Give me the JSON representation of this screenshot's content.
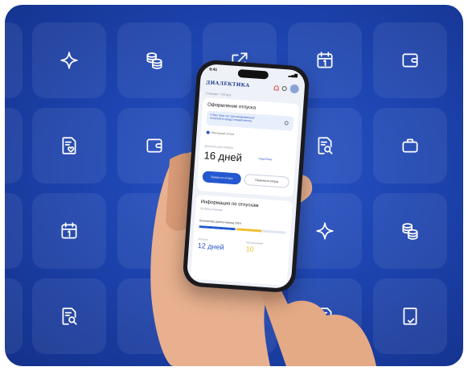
{
  "colors": {
    "background_deep": "#14318a",
    "background_mid": "#1d44b0",
    "accent": "#2358cf",
    "accent_text": "#2a55c2",
    "highlight": "#f0c02e"
  },
  "tiles": [
    {
      "icon": "sparkle-icon"
    },
    {
      "icon": "coins-icon"
    },
    {
      "icon": "external-link-icon"
    },
    {
      "icon": "calendar-icon"
    },
    {
      "icon": "wallet-icon"
    },
    {
      "icon": "document-heart-icon"
    },
    {
      "icon": "wallet-icon"
    },
    {
      "icon": "blank"
    },
    {
      "icon": "document-search-icon"
    },
    {
      "icon": "briefcase-icon"
    },
    {
      "icon": "calendar-icon"
    },
    {
      "icon": "blank"
    },
    {
      "icon": "blank"
    },
    {
      "icon": "sparkle-icon"
    },
    {
      "icon": "coins-icon"
    },
    {
      "icon": "document-search-icon"
    },
    {
      "icon": "blank"
    },
    {
      "icon": "blank"
    },
    {
      "icon": "document-heart-icon"
    },
    {
      "icon": "document-check-icon"
    }
  ],
  "phone": {
    "status": {
      "time": "9:41",
      "signal": "▂▄▆"
    },
    "logo": "ДИАЛЕКТИКА",
    "breadcrumb": "Главная  /  Отпуск",
    "vacation_card": {
      "title": "Оформление отпуска",
      "info": "У Вас пока нет запланированных отпусков в предстоящий месяц",
      "option": "Ежегодный отпуск",
      "days_caption": "Доступно для отпуска",
      "days_value": "16 дней",
      "days_link": "подробнее",
      "primary_button": "Заявка на отпуск",
      "secondary_button": "Перенести отпуск"
    },
    "info_card": {
      "title": "Информация по отпускам",
      "subtitle": "Остатки отпусков",
      "period_line": "Количество дней в период 2024",
      "progress": [
        {
          "share": 0.42,
          "color": "#2358cf"
        },
        {
          "share": 0.3,
          "color": "#f0c02e"
        },
        {
          "share": 0.28,
          "color": "#dfe5f1"
        }
      ],
      "left_caption": "Остаток",
      "left_value": "12 дней",
      "right_caption": "Использовано",
      "right_value": "10"
    }
  }
}
